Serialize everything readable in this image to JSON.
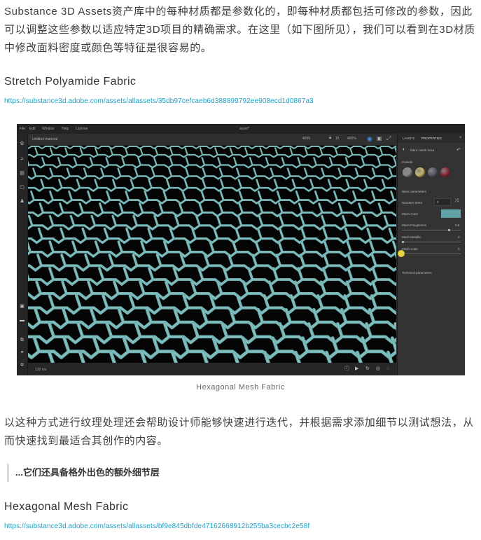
{
  "intro_text": "Substance 3D Assets资产库中的每种材质都是参数化的，即每种材质都包括可修改的参数，因此可以调整这些参数以适应特定3D项目的精确需求。在这里（如下图所见），我们可以看到在3D材质中修改面料密度或颜色等特征是很容易的。",
  "item1": {
    "title": "Stretch Polyamide Fabric",
    "url": "https://substance3d.adobe.com/assets/allassets/35db97cefcaeb6d388899792ee908ecd1d0867a3"
  },
  "screenshot": {
    "menu": [
      "File",
      "Edit",
      "Window",
      "Help",
      "License"
    ],
    "window_title": "asset*",
    "doc_title": "Untitled material",
    "toolbar_values": [
      "4096",
      "16",
      "400%"
    ],
    "status_left": "126 ms",
    "mesh_color": "#5fa3a6",
    "strand_color": "#6fb0b0",
    "panel": {
      "tabs": [
        "LAYERS",
        "PROPERTIES"
      ],
      "material_name": "fabric mesh hexa",
      "presets_label": "Presets",
      "basic_label": "Basic parameters",
      "random_seed_label": "Random Seed",
      "random_seed_value": "0",
      "mesh_color_label": "Mesh Color",
      "roughness_label": "Mesh Roughness",
      "roughness_value": "0.8",
      "metallic_label": "Mesh Metallic",
      "metallic_value": "0",
      "scale_label": "Mesh scale",
      "scale_value": "0",
      "technical_label": "Technical parameters",
      "preset_colors": [
        "#8c8c8c",
        "#c9b86a",
        "#5a5a6a",
        "#8a2a3a"
      ]
    }
  },
  "caption1": "Hexagonal Mesh Fabric",
  "body_text": "以这种方式进行纹理处理还会帮助设计师能够快速进行迭代，并根据需求添加细节以测试想法，从而快速找到最适合其创作的内容。",
  "quote_text": "...它们还具备格外出色的额外细节层",
  "item2": {
    "title": "Hexagonal Mesh Fabric",
    "url": "https://substance3d.adobe.com/assets/allassets/bf9e845dbfde47162668912b255ba3cecbc2e58f"
  }
}
